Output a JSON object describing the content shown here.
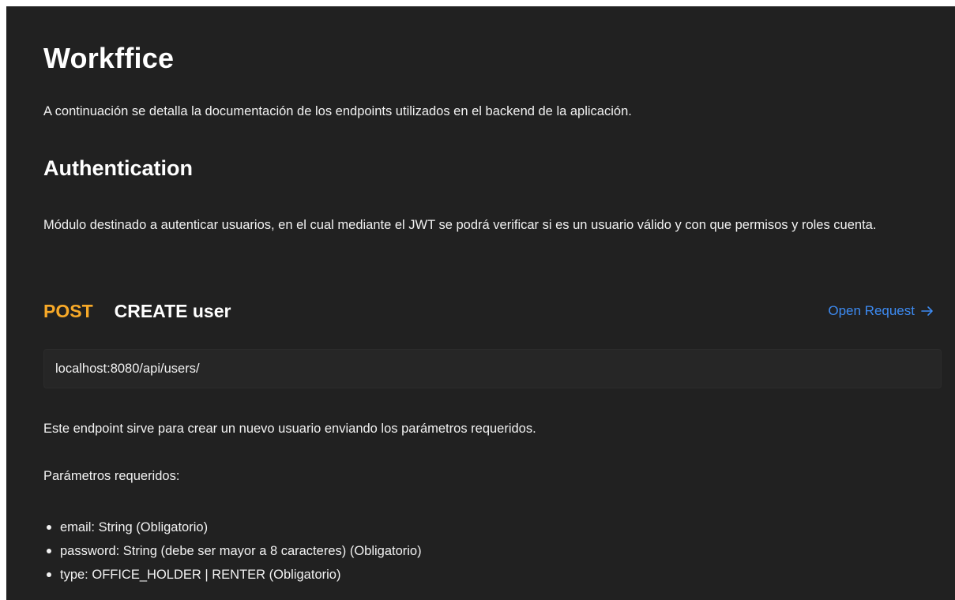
{
  "doc": {
    "title": "Workffice",
    "intro": "A continuación se detalla la documentación de los endpoints utilizados en el backend de la aplicación.",
    "section": {
      "title": "Authentication",
      "description": "Módulo destinado a autenticar usuarios, en el cual mediante el JWT se podrá verificar si es un usuario válido y con que permisos y roles cuenta."
    },
    "endpoint": {
      "method": "POST",
      "name": "CREATE user",
      "open_request_label": "Open Request",
      "open_request_icon": "arrow-right-icon",
      "url": "localhost:8080/api/users/",
      "description": "Este endpoint sirve para crear un nuevo usuario enviando los parámetros requeridos.",
      "params_label": "Parámetros requeridos:",
      "params": [
        "email: String (Obligatorio)",
        "password: String (debe ser mayor a 8 caracteres) (Obligatorio)",
        "type: OFFICE_HOLDER | RENTER (Obligatorio)"
      ]
    }
  },
  "colors": {
    "background": "#212121",
    "text": "#f2f2f2",
    "method_post": "#f7a928",
    "link": "#3d8bf2",
    "url_box": "#262626"
  }
}
